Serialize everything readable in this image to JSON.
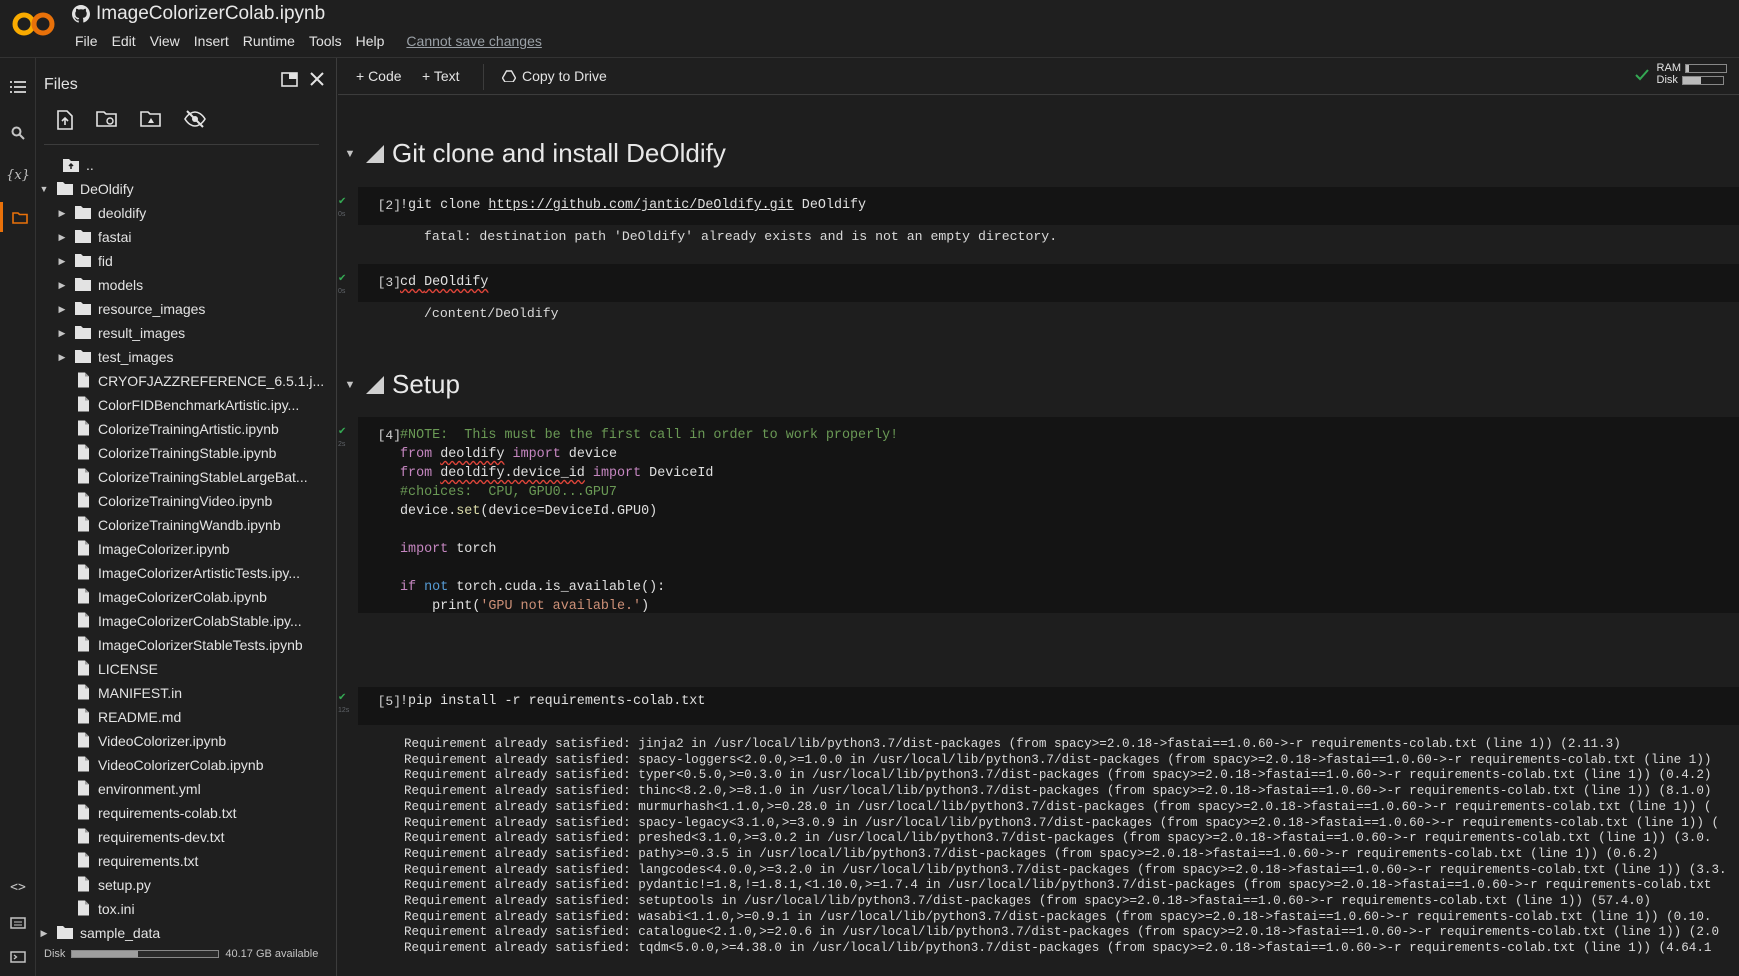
{
  "header": {
    "notebook_title": "ImageColorizerColab.ipynb",
    "logo_text": "CO",
    "menu": [
      "File",
      "Edit",
      "View",
      "Insert",
      "Runtime",
      "Tools",
      "Help"
    ],
    "save_warning": "Cannot save changes"
  },
  "toolbar": {
    "code_label": "+ Code",
    "text_label": "+ Text",
    "drive_label": "Copy to Drive",
    "ram_label": "RAM",
    "disk_label": "Disk",
    "ram_fraction": 0.08,
    "disk_fraction": 0.45
  },
  "files_panel": {
    "title": "Files",
    "parent_label": "..",
    "tree": [
      {
        "label": "DeOldify",
        "type": "folder",
        "depth": 0,
        "expanded": true
      },
      {
        "label": "deoldify",
        "type": "folder",
        "depth": 1
      },
      {
        "label": "fastai",
        "type": "folder",
        "depth": 1
      },
      {
        "label": "fid",
        "type": "folder",
        "depth": 1
      },
      {
        "label": "models",
        "type": "folder",
        "depth": 1
      },
      {
        "label": "resource_images",
        "type": "folder",
        "depth": 1
      },
      {
        "label": "result_images",
        "type": "folder",
        "depth": 1
      },
      {
        "label": "test_images",
        "type": "folder",
        "depth": 1
      },
      {
        "label": "CRYOFJAZZREFERENCE_6.5.1.j...",
        "type": "file",
        "depth": 1
      },
      {
        "label": "ColorFIDBenchmarkArtistic.ipy...",
        "type": "file",
        "depth": 1
      },
      {
        "label": "ColorizeTrainingArtistic.ipynb",
        "type": "file",
        "depth": 1
      },
      {
        "label": "ColorizeTrainingStable.ipynb",
        "type": "file",
        "depth": 1
      },
      {
        "label": "ColorizeTrainingStableLargeBat...",
        "type": "file",
        "depth": 1
      },
      {
        "label": "ColorizeTrainingVideo.ipynb",
        "type": "file",
        "depth": 1
      },
      {
        "label": "ColorizeTrainingWandb.ipynb",
        "type": "file",
        "depth": 1
      },
      {
        "label": "ImageColorizer.ipynb",
        "type": "file",
        "depth": 1
      },
      {
        "label": "ImageColorizerArtisticTests.ipy...",
        "type": "file",
        "depth": 1
      },
      {
        "label": "ImageColorizerColab.ipynb",
        "type": "file",
        "depth": 1
      },
      {
        "label": "ImageColorizerColabStable.ipy...",
        "type": "file",
        "depth": 1
      },
      {
        "label": "ImageColorizerStableTests.ipynb",
        "type": "file",
        "depth": 1
      },
      {
        "label": "LICENSE",
        "type": "file",
        "depth": 1
      },
      {
        "label": "MANIFEST.in",
        "type": "file",
        "depth": 1
      },
      {
        "label": "README.md",
        "type": "file",
        "depth": 1
      },
      {
        "label": "VideoColorizer.ipynb",
        "type": "file",
        "depth": 1
      },
      {
        "label": "VideoColorizerColab.ipynb",
        "type": "file",
        "depth": 1
      },
      {
        "label": "environment.yml",
        "type": "file",
        "depth": 1
      },
      {
        "label": "requirements-colab.txt",
        "type": "file",
        "depth": 1
      },
      {
        "label": "requirements-dev.txt",
        "type": "file",
        "depth": 1
      },
      {
        "label": "requirements.txt",
        "type": "file",
        "depth": 1
      },
      {
        "label": "setup.py",
        "type": "file",
        "depth": 1
      },
      {
        "label": "tox.ini",
        "type": "file",
        "depth": 1
      },
      {
        "label": "sample_data",
        "type": "folder",
        "depth": 0
      }
    ],
    "disk_label": "Disk",
    "disk_available": "40.17 GB available",
    "disk_fraction": 0.45
  },
  "notebook": {
    "section1": "Git clone and install DeOldify",
    "cell2": {
      "number": "[2]",
      "time": "0s",
      "code_cmd": "!git clone ",
      "code_url": "https://github.com/jantic/DeOldify.git",
      "code_tail": " DeOldify",
      "output": "fatal: destination path 'DeOldify' already exists and is not an empty directory."
    },
    "cell3": {
      "number": "[3]",
      "time": "0s",
      "code_cmd": "cd ",
      "code_arg": "DeOldify",
      "output": "/content/DeOldify"
    },
    "section2": "Setup",
    "cell4": {
      "number": "[4]",
      "time": "2s",
      "note": "#NOTE:  This must be the first call in order to work properly!",
      "from1": "from",
      "mod1": "deoldify",
      "import1": "import",
      "name1": " device",
      "from2": "from",
      "mod2": "deoldify.device_id",
      "import2": "import",
      "name2": " DeviceId",
      "choices": "#choices:  CPU, GPU0...GPU7",
      "set_pre": "device.",
      "set_fn": "set",
      "set_post": "(device=DeviceId.GPU0)",
      "import3": "import",
      "torch": " torch",
      "if_kw": "if",
      "not_kw": "not",
      "cond": " torch.cuda.is_available():",
      "print_pre": "    print(",
      "print_str": "'GPU not available.'",
      "print_post": ")"
    },
    "cell5": {
      "number": "[5]",
      "time": "12s",
      "code": "!pip install -r requirements-colab.txt",
      "output": [
        "Requirement already satisfied: jinja2 in /usr/local/lib/python3.7/dist-packages (from spacy>=2.0.18->fastai==1.0.60->-r requirements-colab.txt (line 1)) (2.11.3)",
        "Requirement already satisfied: spacy-loggers<2.0.0,>=1.0.0 in /usr/local/lib/python3.7/dist-packages (from spacy>=2.0.18->fastai==1.0.60->-r requirements-colab.txt (line 1))",
        "Requirement already satisfied: typer<0.5.0,>=0.3.0 in /usr/local/lib/python3.7/dist-packages (from spacy>=2.0.18->fastai==1.0.60->-r requirements-colab.txt (line 1)) (0.4.2)",
        "Requirement already satisfied: thinc<8.2.0,>=8.1.0 in /usr/local/lib/python3.7/dist-packages (from spacy>=2.0.18->fastai==1.0.60->-r requirements-colab.txt (line 1)) (8.1.0)",
        "Requirement already satisfied: murmurhash<1.1.0,>=0.28.0 in /usr/local/lib/python3.7/dist-packages (from spacy>=2.0.18->fastai==1.0.60->-r requirements-colab.txt (line 1)) (",
        "Requirement already satisfied: spacy-legacy<3.1.0,>=3.0.9 in /usr/local/lib/python3.7/dist-packages (from spacy>=2.0.18->fastai==1.0.60->-r requirements-colab.txt (line 1)) (",
        "Requirement already satisfied: preshed<3.1.0,>=3.0.2 in /usr/local/lib/python3.7/dist-packages (from spacy>=2.0.18->fastai==1.0.60->-r requirements-colab.txt (line 1)) (3.0.",
        "Requirement already satisfied: pathy>=0.3.5 in /usr/local/lib/python3.7/dist-packages (from spacy>=2.0.18->fastai==1.0.60->-r requirements-colab.txt (line 1)) (0.6.2)",
        "Requirement already satisfied: langcodes<4.0.0,>=3.2.0 in /usr/local/lib/python3.7/dist-packages (from spacy>=2.0.18->fastai==1.0.60->-r requirements-colab.txt (line 1)) (3.3.",
        "Requirement already satisfied: pydantic!=1.8,!=1.8.1,<1.10.0,>=1.7.4 in /usr/local/lib/python3.7/dist-packages (from spacy>=2.0.18->fastai==1.0.60->-r requirements-colab.txt",
        "Requirement already satisfied: setuptools in /usr/local/lib/python3.7/dist-packages (from spacy>=2.0.18->fastai==1.0.60->-r requirements-colab.txt (line 1)) (57.4.0)",
        "Requirement already satisfied: wasabi<1.1.0,>=0.9.1 in /usr/local/lib/python3.7/dist-packages (from spacy>=2.0.18->fastai==1.0.60->-r requirements-colab.txt (line 1)) (0.10.",
        "Requirement already satisfied: catalogue<2.1.0,>=2.0.6 in /usr/local/lib/python3.7/dist-packages (from spacy>=2.0.18->fastai==1.0.60->-r requirements-colab.txt (line 1)) (2.0",
        "Requirement already satisfied: tqdm<5.0.0,>=4.38.0 in /usr/local/lib/python3.7/dist-packages (from spacy>=2.0.18->fastai==1.0.60->-r requirements-colab.txt (line 1)) (4.64.1"
      ]
    }
  },
  "colors": {
    "accent": "#e8710a",
    "logo_orange": "#f9ab00",
    "success": "#34a853"
  }
}
